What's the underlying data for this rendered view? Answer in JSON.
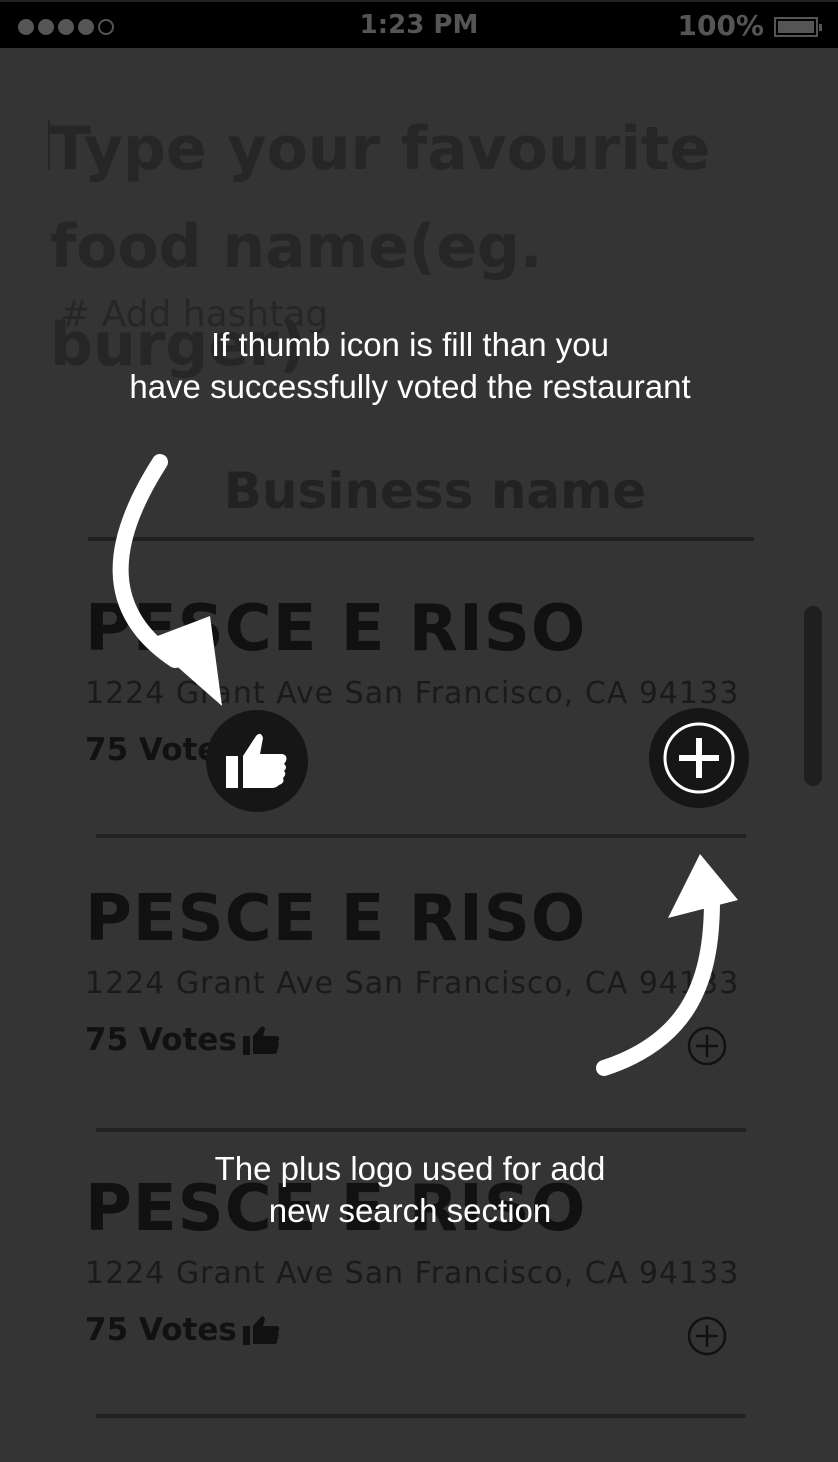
{
  "status_bar": {
    "time": "1:23 PM",
    "battery_percent": "100%",
    "signal_icon": "signal-dots-icon",
    "battery_icon": "battery-icon"
  },
  "search": {
    "query_line1": "Type your favourite",
    "query_line2": "food name(eg. burger)",
    "hashtag_placeholder": "# Add hashtag"
  },
  "business_label": "Business name",
  "results": [
    {
      "name": "PESCE E RISO",
      "address": "1224 Grant Ave San Francisco, CA 94133",
      "votes": "75 Votes"
    },
    {
      "name": "PESCE E RISO",
      "address": "1224 Grant Ave San Francisco, CA 94133",
      "votes": "75 Votes"
    },
    {
      "name": "PESCE E RISO",
      "address": "1224 Grant Ave San Francisco, CA 94133",
      "votes": "75 Votes"
    }
  ],
  "overlay": {
    "thumb_tip_line1": "If  thumb icon is fill than you",
    "thumb_tip_line2": "have successfully voted the restaurant",
    "plus_tip_line1": "The plus logo used for add",
    "plus_tip_line2": "new search section"
  },
  "colors": {
    "overlay_background": "#343434",
    "status_bar": "#000000",
    "highlight_circle": "#161616",
    "annotation_text": "#ffffff"
  }
}
